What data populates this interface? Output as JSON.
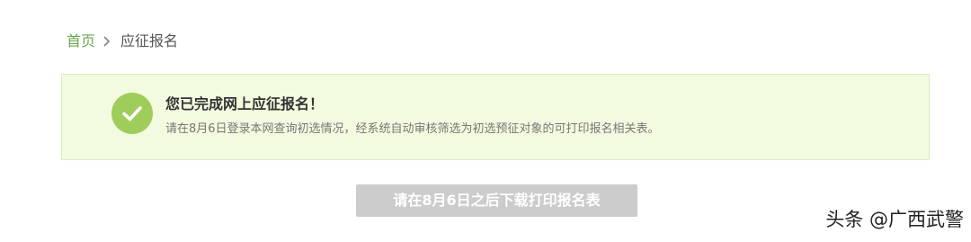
{
  "breadcrumb": {
    "home_label": "首页",
    "separator_icon": "chevron-right-icon",
    "current_label": "应征报名"
  },
  "notice": {
    "icon": "check-circle-icon",
    "title": "您已完成网上应征报名！",
    "description": "请在8月6日登录本网查询初选情况，经系统自动审核筛选为初选预征对象的可打印报名相关表。"
  },
  "download_button": {
    "label": "请在8月6日之后下载打印报名表",
    "state": "disabled"
  },
  "watermark": {
    "text": "头条 @广西武警"
  },
  "colors": {
    "link_green": "#6aa84f",
    "notice_background": "#f2fbdf",
    "notice_border": "#dbeec0",
    "check_circle": "#9fcd5a",
    "button_disabled": "#cccccc"
  }
}
